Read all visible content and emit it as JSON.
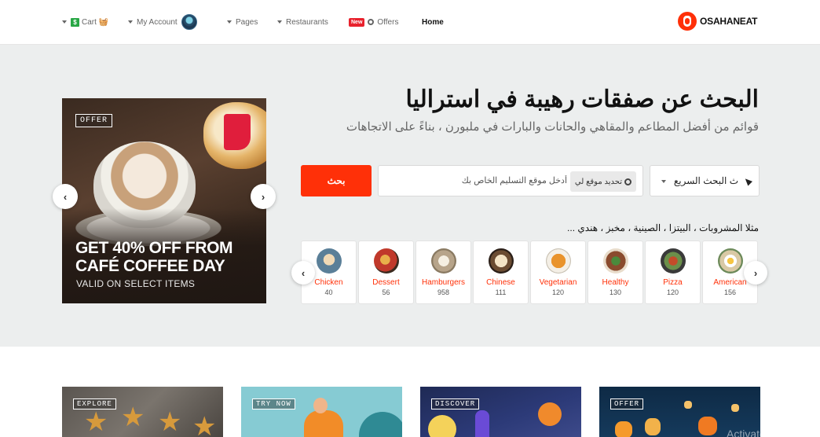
{
  "nav": {
    "cart_label": "Cart",
    "cart_badge": "$",
    "account_label": "My Account",
    "pages_label": "Pages",
    "restaurants_label": "Restaurants",
    "new_badge": "New",
    "offers_label": "Offers",
    "home_label": "Home",
    "logo_text": "OSAHANEAT"
  },
  "promo": {
    "tag": "OFFER",
    "headline_line1": "GET 40% OFF FROM",
    "headline_line2": "CAFÉ COFFEE DAY",
    "subline": "VALID ON SELECT ITEMS"
  },
  "hero": {
    "title": "البحث عن صفقات رهيبة في استراليا",
    "subtitle": "قوائم من أفضل المطاعم والمقاهي والحانات والبارات في ملبورن ، بناءً على الاتجاهات"
  },
  "search": {
    "type_value": "ث البحث السريع",
    "placeholder": "أدخل موقع التسليم الخاص بك",
    "locate_label": "تحديد موقع لي",
    "button_label": "بحث",
    "examples": "مثلا المشروبات ، البيتزا ، الصينية ، مخبز ، هندي ..."
  },
  "categories": [
    {
      "name": "Chicken",
      "count": "40",
      "color": "#5a7f98"
    },
    {
      "name": "Dessert",
      "count": "56",
      "color": "#c0392b"
    },
    {
      "name": "Hamburgers",
      "count": "958",
      "color": "#b7a48a"
    },
    {
      "name": "Chinese",
      "count": "111",
      "color": "#6b4c32"
    },
    {
      "name": "Vegetarian",
      "count": "120",
      "color": "#d9822b"
    },
    {
      "name": "Healthy",
      "count": "130",
      "color": "#8a4b2e"
    },
    {
      "name": "Pizza",
      "count": "120",
      "color": "#6b8f4a"
    },
    {
      "name": "American",
      "count": "156",
      "color": "#d9c9a5"
    }
  ],
  "offer_cards": [
    {
      "tag": "EXPLORE"
    },
    {
      "tag": "TRY NOW"
    },
    {
      "tag": "DISCOVER"
    },
    {
      "tag": "OFFER"
    }
  ],
  "watermark": "Activate Wind"
}
